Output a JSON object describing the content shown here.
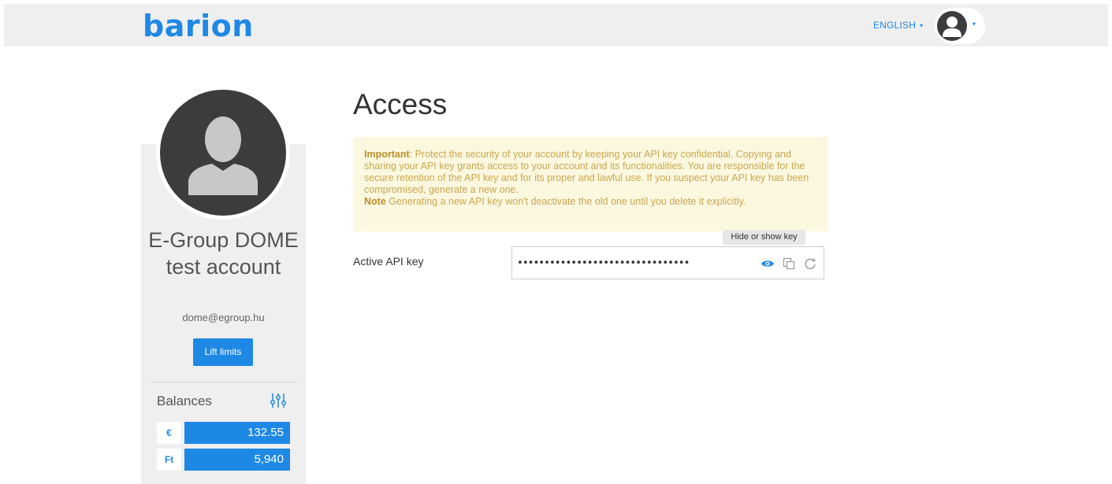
{
  "header": {
    "logo_text": "barion",
    "language_label": "ENGLISH",
    "language_caret": "▾",
    "user_caret": "▾",
    "brand_color": "#1e88e5"
  },
  "sidebar": {
    "account_name": "E-Group DOME test account",
    "email": "dome@egroup.hu",
    "lift_limits_label": "Lift limits",
    "balances_title": "Balances",
    "balances": [
      {
        "currency": "€",
        "amount": "132.55"
      },
      {
        "currency": "Ft",
        "amount": "5,940"
      }
    ]
  },
  "main": {
    "title": "Access",
    "notice": {
      "important_label": "Important",
      "important_text": ": Protect the security of your account by keeping your API key confidential. Copying and sharing your API key grants access to your account and its functionalities. You are responsible for the secure retention of the API key and for its proper and lawful use. If you suspect your API key has been compromised, generate a new one.",
      "note_label": "Note",
      "note_text": " Generating a new API key won't deactivate the old one until you delete it explicitly."
    },
    "api_key": {
      "label": "Active API key",
      "value": "••••••••••••••••••••••••••••••••",
      "tooltip": "Hide or show key"
    }
  },
  "icons": {
    "user": "user-silhouette-icon",
    "sliders": "sliders-icon",
    "eye": "eye-icon",
    "copy": "copy-icon",
    "regenerate": "regenerate-icon"
  }
}
